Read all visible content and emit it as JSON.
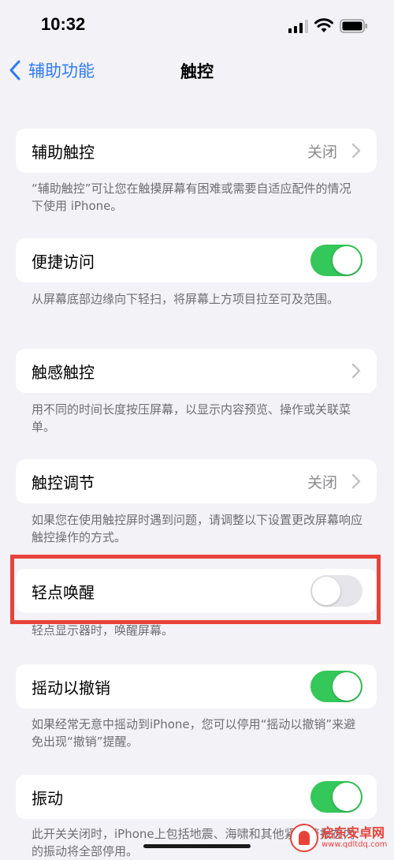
{
  "status": {
    "time": "10:32"
  },
  "nav": {
    "back_label": "辅助功能",
    "title": "触控"
  },
  "rows": [
    {
      "label": "辅助触控",
      "value": "关闭",
      "desc": "“辅助触控”可让您在触摸屏幕有困难或需要自适应配件的情况下使用 iPhone。"
    },
    {
      "label": "便捷访问",
      "toggle": "on",
      "desc": "从屏幕底部边缘向下轻扫，将屏幕上方项目拉至可及范围。"
    },
    {
      "label": "触感触控",
      "desc": "用不同的时间长度按压屏幕，以显示内容预览、操作或关联菜单。"
    },
    {
      "label": "触控调节",
      "value": "关闭",
      "desc": "如果您在使用触控屏时遇到问题，请调整以下设置更改屏幕响应触控操作的方式。"
    },
    {
      "label": "轻点唤醒",
      "toggle": "off",
      "desc": "轻点显示器时，唤醒屏幕。"
    },
    {
      "label": "摇动以撤销",
      "toggle": "on",
      "desc": "如果经常无意中摇动到iPhone，您可以停用“摇动以撤销”来避免出现“撤销”提醒。"
    },
    {
      "label": "振动",
      "toggle": "on",
      "desc": "此开关关闭时，iPhone上包括地震、海啸和其他紧急警报在内的振动将全部停用。"
    }
  ],
  "watermark": {
    "name": "启东安卓网",
    "url": "www.qdltdq.com"
  },
  "colors": {
    "accent": "#2f7bf5",
    "toggle_on": "#34c759",
    "highlight": "#e8433a",
    "background": "#f2f2f7"
  }
}
